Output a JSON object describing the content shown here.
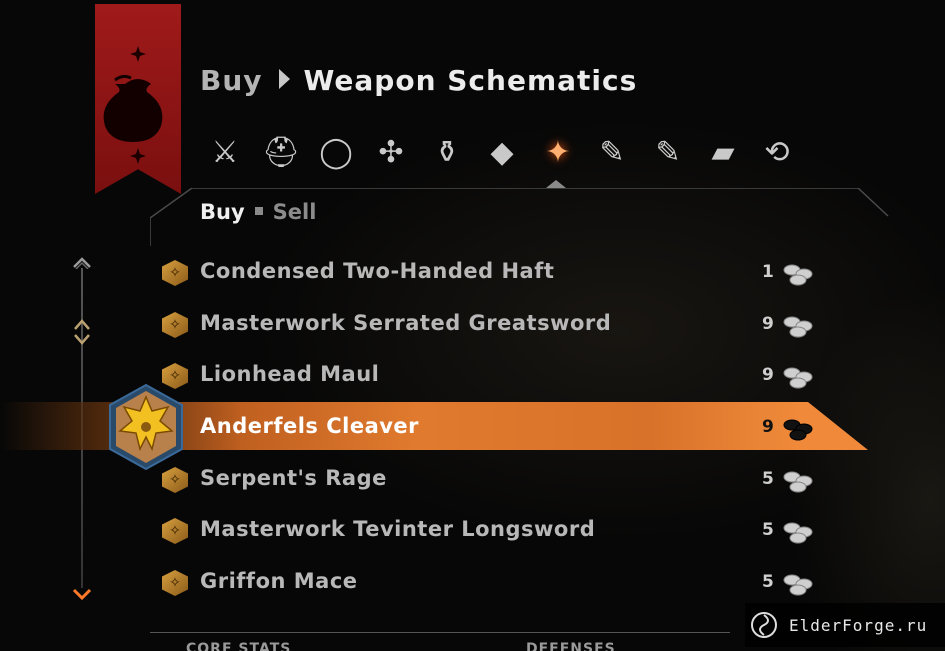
{
  "header": {
    "crumb": "Buy",
    "title": "Weapon Schematics"
  },
  "categories": [
    {
      "icon": "axes-icon",
      "glyph": "⚔"
    },
    {
      "icon": "helmet-icon",
      "glyph": "⛑"
    },
    {
      "icon": "ring-icon",
      "glyph": "◯"
    },
    {
      "icon": "hilt-icon",
      "glyph": "✣"
    },
    {
      "icon": "mortar-icon",
      "glyph": "⚱"
    },
    {
      "icon": "gem-icon",
      "glyph": "◆"
    },
    {
      "icon": "weapon-schematic-icon",
      "glyph": "✦",
      "active": true
    },
    {
      "icon": "armor-schematic-icon",
      "glyph": "✎"
    },
    {
      "icon": "upgrade-schematic-icon",
      "glyph": "✎"
    },
    {
      "icon": "book-icon",
      "glyph": "▰"
    },
    {
      "icon": "buyback-icon",
      "glyph": "⟲"
    }
  ],
  "subtabs": {
    "buy": "Buy",
    "sell": "Sell"
  },
  "items": [
    {
      "name": "Condensed Two-Handed Haft",
      "price": "1",
      "icon": "haft-icon"
    },
    {
      "name": "Masterwork Serrated Greatsword",
      "price": "9",
      "icon": "greatsword-icon"
    },
    {
      "name": "Lionhead Maul",
      "price": "9",
      "icon": "maul-icon"
    },
    {
      "name": "Anderfels Cleaver",
      "price": "9",
      "icon": "cleaver-icon",
      "selected": true
    },
    {
      "name": "Serpent's Rage",
      "price": "5",
      "icon": "serpent-icon"
    },
    {
      "name": "Masterwork Tevinter Longsword",
      "price": "5",
      "icon": "longsword-icon"
    },
    {
      "name": "Griffon Mace",
      "price": "5",
      "icon": "mace-icon"
    }
  ],
  "bottom": {
    "left": "Core Stats",
    "right": "Defenses"
  },
  "watermark": "ElderForge.ru",
  "colors": {
    "banner": "#a01a1a",
    "accent": "#e07a2e"
  }
}
